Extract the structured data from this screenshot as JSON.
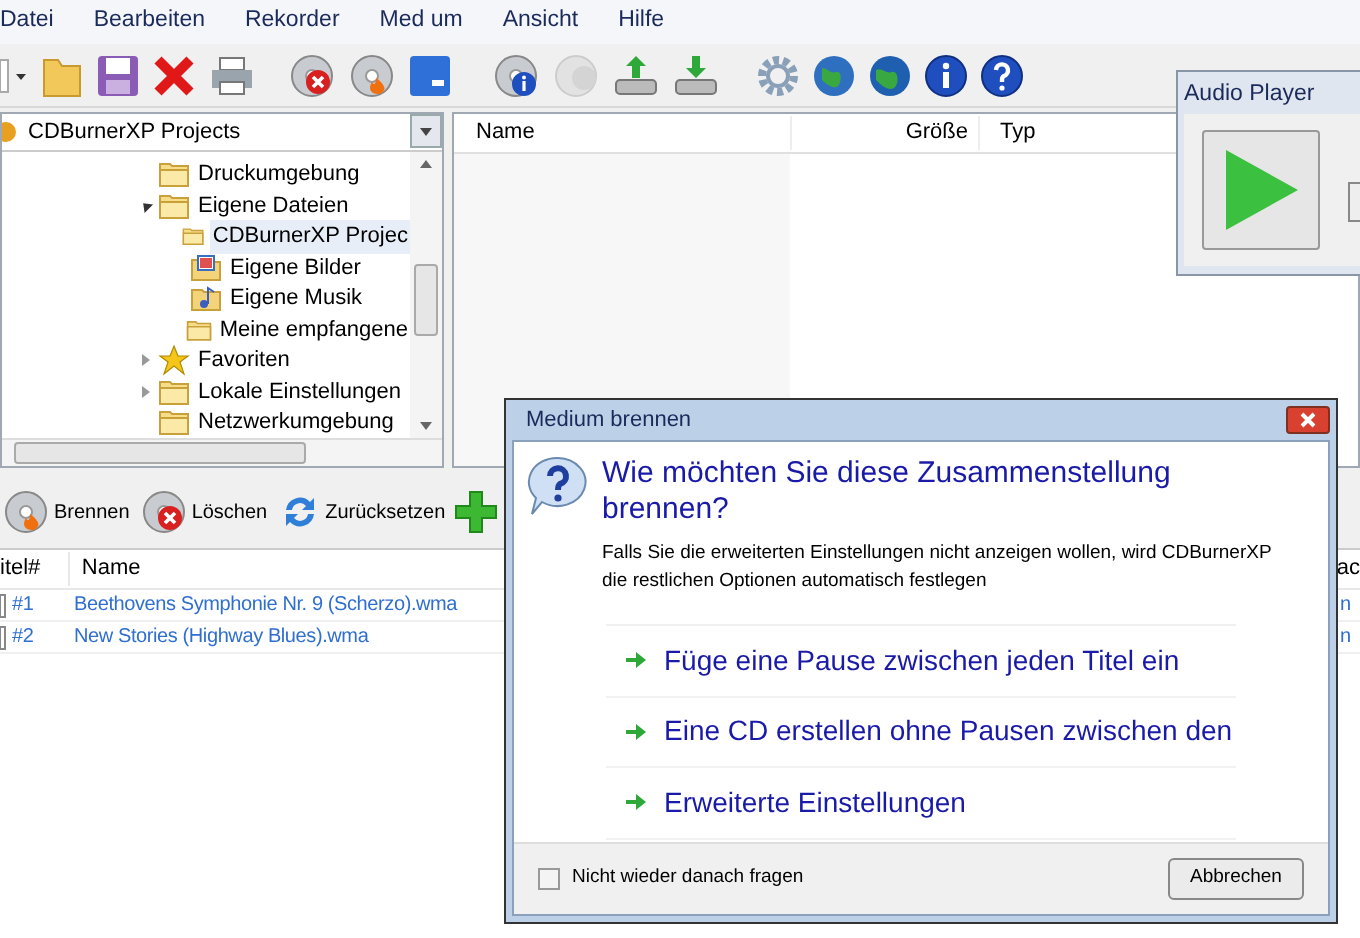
{
  "menu": [
    "Datei",
    "Bearbeiten",
    "Rekorder",
    "Med um",
    "Ansicht",
    "Hilfe"
  ],
  "folder_combo": {
    "value": "CDBurnerXP Projects"
  },
  "tree": [
    {
      "label": "Druckumgebung",
      "kind": "folder",
      "selected": false
    },
    {
      "label": "Eigene Dateien",
      "kind": "folder",
      "expanded": true,
      "selected": false,
      "children": [
        {
          "label": "CDBurnerXP Projec",
          "kind": "folder",
          "selected": true
        },
        {
          "label": "Eigene Bilder",
          "kind": "pictures",
          "selected": false
        },
        {
          "label": "Eigene Musik",
          "kind": "music",
          "selected": false
        },
        {
          "label": "Meine empfangene",
          "kind": "folder",
          "selected": false
        }
      ]
    },
    {
      "label": "Favoriten",
      "kind": "star",
      "expanded": false,
      "selected": false
    },
    {
      "label": "Lokale Einstellungen",
      "kind": "folder",
      "expanded": false,
      "selected": false
    },
    {
      "label": "Netzwerkumgebung",
      "kind": "folder",
      "selected": false
    }
  ],
  "file_list": {
    "columns": [
      "Name",
      "Größe",
      "Typ"
    ]
  },
  "audio_player": {
    "title": "Audio Player"
  },
  "compilation_toolbar": [
    {
      "label": "Brennen",
      "kind": "burn"
    },
    {
      "label": "Löschen",
      "kind": "delete"
    },
    {
      "label": "Zurücksetzen",
      "kind": "reset"
    },
    {
      "kind": "add"
    }
  ],
  "tracks": {
    "columns": [
      "itel#",
      "Name",
      "ac"
    ],
    "rows": [
      {
        "number": "#1",
        "name": "Beethovens Symphonie Nr. 9 (Scherzo).wma",
        "column_3": "n"
      },
      {
        "number": "#2",
        "name": "New Stories (Highway Blues).wma",
        "column_3": "n"
      }
    ]
  },
  "dialog": {
    "title": "Medium brennen",
    "heading": "Wie möchten Sie diese Zusammenstellung brennen?",
    "description": "Falls Sie die erweiterten Einstellungen nicht anzeigen wollen, wird CDBurnerXP die restlichen Optionen automatisch festlegen",
    "options": [
      "Füge eine Pause zwischen jeden Titel ein",
      "Eine CD erstellen ohne Pausen zwischen den",
      "Erweiterte Einstellungen"
    ],
    "dont_ask": {
      "label": "Nicht wieder danach fragen",
      "checked": false
    },
    "cancel": "Abbrechen"
  }
}
